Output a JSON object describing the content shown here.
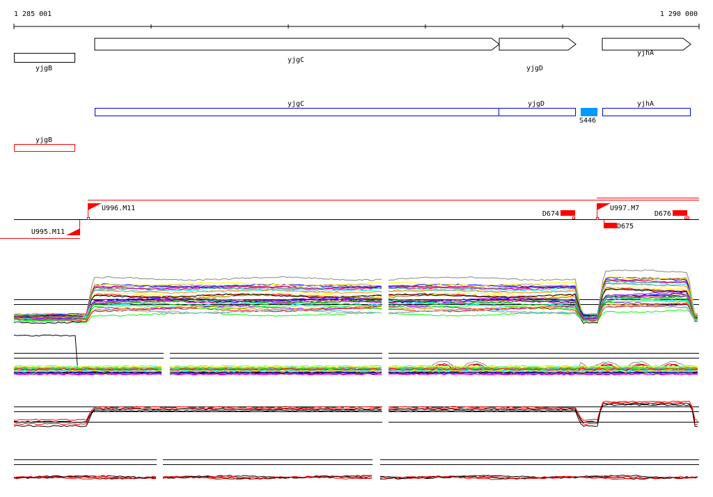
{
  "ruler": {
    "start_label": "1 285 001",
    "end_label": "1 290 000"
  },
  "genes": [
    {
      "name": "yjgC",
      "strand": "+"
    },
    {
      "name": "yjgD",
      "strand": "+"
    },
    {
      "name": "yjhA",
      "strand": "+"
    },
    {
      "name": "yjgB",
      "strand": "-"
    }
  ],
  "annotations": {
    "blue": [
      "yjgC",
      "yjgD",
      "yjhA"
    ],
    "blue_feature": "S446",
    "red": [
      "yjgB"
    ]
  },
  "transcripts": {
    "upstream": [
      "U996.M11",
      "U997.M7",
      "U995.M11"
    ],
    "downstream": [
      "D674",
      "D676",
      "D675"
    ]
  },
  "colors": {
    "gene_outline": "#000000",
    "annotation_blue": "#0000dd",
    "feature_blue": "#0099ff",
    "transcript_red": "#ff0000",
    "palette": [
      "#000000",
      "#888888",
      "#ff0000",
      "#ff00ff",
      "#00ff00",
      "#0000ff",
      "#00ffff",
      "#ffff00",
      "#ff8800",
      "#8800ff",
      "#00aa00",
      "#aaaaaa",
      "#cc0066",
      "#33cccc",
      "#996633"
    ]
  }
}
